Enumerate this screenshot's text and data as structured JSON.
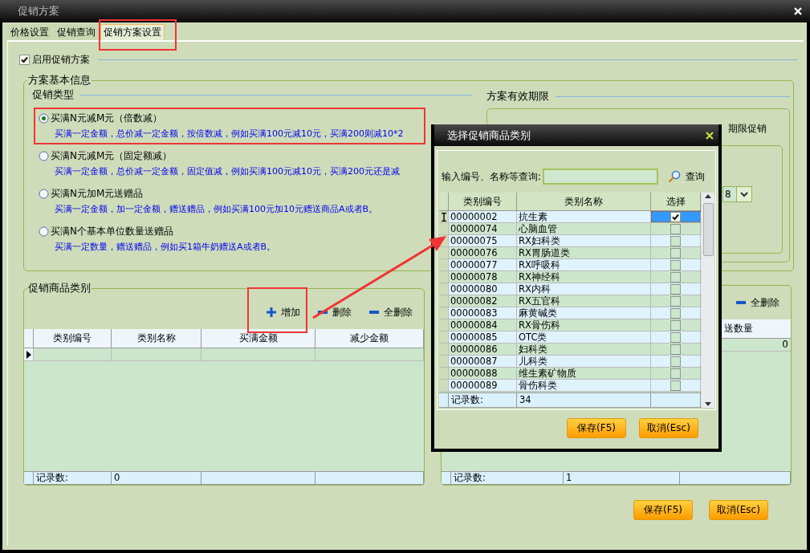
{
  "window": {
    "title": "促销方案"
  },
  "tabs": [
    {
      "label": "价格设置",
      "selected": false
    },
    {
      "label": "促销查询",
      "selected": false
    },
    {
      "label": "促销方案设置",
      "selected": true
    }
  ],
  "enable_promotion": {
    "label": "启用促销方案",
    "checked": true
  },
  "basic_info": {
    "title": "方案基本信息",
    "promotion_type": {
      "title": "促销类型",
      "options": [
        {
          "label": "买满N元减M元（倍数减）",
          "description": "买满一定金额，总价减一定金额，按倍数减，例如买满100元减10元，买满200则减10*2",
          "selected": true
        },
        {
          "label": "买满N元减M元（固定额减）",
          "description": "买满一定金额，总价减一定金额，固定值减，例如买满100元减10元，买满200元还是减",
          "selected": false
        },
        {
          "label": "买满N元加M元送赠品",
          "description": "买满一定金额，加一定金额，赠送赠品，例如买满100元加10元赠送商品A或者B。",
          "selected": false
        },
        {
          "label": "买满N个基本单位数量送赠品",
          "description": "买满一定数量，赠送赠品，例如买1箱牛奶赠送A或者B。",
          "selected": false
        }
      ]
    },
    "validity": {
      "title": "方案有效期限",
      "option_label": "期限促销",
      "combo_value": "8"
    }
  },
  "category_group": {
    "title": "促销商品类别",
    "toolbar": [
      {
        "label": "增加",
        "kind": "add"
      },
      {
        "label": "删除",
        "kind": "remove"
      },
      {
        "label": "全删除",
        "kind": "remove"
      }
    ],
    "columns": [
      "类别编号",
      "类别名称",
      "买满金额",
      "减少金额"
    ],
    "footer": {
      "label": "记录数:",
      "value": "0"
    }
  },
  "gift_group": {
    "toolbar": [
      {
        "label": "全删除",
        "kind": "remove"
      }
    ],
    "column": "送数量",
    "row_value": "0",
    "footer": {
      "label": "记录数:",
      "value": "1"
    }
  },
  "buttons": [
    "保存(F5)",
    "取消(Esc)"
  ],
  "dialog": {
    "title": "选择促销商品类别",
    "search": {
      "label": "输入编号、名称等查询:",
      "button": "查询"
    },
    "columns": [
      "类别编号",
      "类别名称",
      "选择"
    ],
    "rows": [
      {
        "code": "00000002",
        "name": "抗生素",
        "checked": true,
        "selected": true
      },
      {
        "code": "00000074",
        "name": "心脑血管",
        "checked": false,
        "selected": false
      },
      {
        "code": "00000075",
        "name": "RX妇科类",
        "checked": false,
        "selected": false
      },
      {
        "code": "00000076",
        "name": "RX胃肠道类",
        "checked": false,
        "selected": false
      },
      {
        "code": "00000077",
        "name": "RX呼吸科",
        "checked": false,
        "selected": false
      },
      {
        "code": "00000078",
        "name": "RX神经科",
        "checked": false,
        "selected": false
      },
      {
        "code": "00000080",
        "name": "RX内科",
        "checked": false,
        "selected": false
      },
      {
        "code": "00000082",
        "name": "RX五官科",
        "checked": false,
        "selected": false
      },
      {
        "code": "00000083",
        "name": "麻黄碱类",
        "checked": false,
        "selected": false
      },
      {
        "code": "00000084",
        "name": "RX骨伤科",
        "checked": false,
        "selected": false
      },
      {
        "code": "00000085",
        "name": "OTC类",
        "checked": false,
        "selected": false
      },
      {
        "code": "00000086",
        "name": "妇科类",
        "checked": false,
        "selected": false
      },
      {
        "code": "00000087",
        "name": "儿科类",
        "checked": false,
        "selected": false
      },
      {
        "code": "00000088",
        "name": "维生素矿物质",
        "checked": false,
        "selected": false
      },
      {
        "code": "00000089",
        "name": "骨伤科类",
        "checked": false,
        "selected": false
      }
    ],
    "footer": {
      "label": "记录数:",
      "value": "34"
    },
    "buttons": [
      "保存(F5)",
      "取消(Esc)"
    ]
  }
}
